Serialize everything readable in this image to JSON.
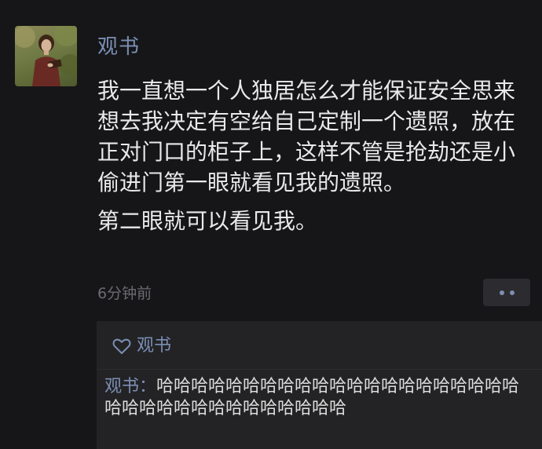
{
  "post": {
    "author": "观书",
    "paragraphs": [
      "我一直想一个人独居怎么才能保证安全思来想去我决定有空给自己定制一个遗照，放在正对门口的柜子上，这样不管是抢劫还是小偷进门第一眼就看见我的遗照。",
      "第二眼就可以看见我。"
    ],
    "timestamp": "6分钟前",
    "more_icon": "more-dots-icon"
  },
  "likes": {
    "icon": "heart-outline-icon",
    "names": "观书"
  },
  "comment": {
    "author": "观书",
    "separator": "：",
    "text": "哈哈哈哈哈哈哈哈哈哈哈哈哈哈哈哈哈哈哈哈哈哈哈哈哈哈哈哈哈哈哈哈哈哈哈"
  },
  "colors": {
    "background": "#161618",
    "link_blue": "#7b8fb4",
    "body_text": "#e9e9ea",
    "muted_text": "#6b6b70",
    "comment_bg": "#232325"
  }
}
